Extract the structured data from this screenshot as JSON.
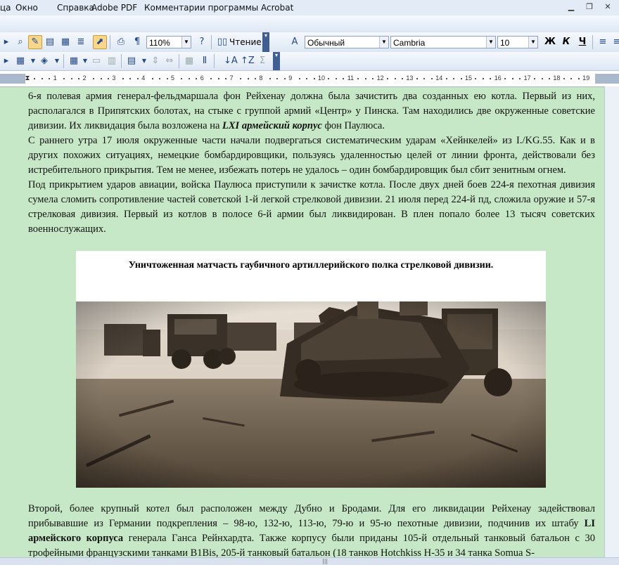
{
  "menu": {
    "items": [
      "ца",
      "Окно",
      "Справка",
      "Adobe PDF",
      "Комментарии программы Acrobat"
    ]
  },
  "toolbar": {
    "zoom": "110%",
    "read_label": "Чтение",
    "style": "Обычный",
    "font": "Cambria",
    "size": "10",
    "bold": "Ж",
    "italic": "К",
    "underline": "Ч"
  },
  "ruler": {
    "labels": [
      "1",
      "2",
      "3",
      "4",
      "5",
      "6",
      "7",
      "8",
      "9",
      "10",
      "11",
      "12",
      "13",
      "14",
      "15",
      "16",
      "17",
      "18",
      "19"
    ]
  },
  "document": {
    "p1_a": "6-я полевая армия генерал-фельдмаршала фон Рейхенау должна была зачистить два созданных ею котла. Первый из них, располагался в Припятских болотах, на стыке с группой армий «Центр» у Пинска. Там находились две окруженные советские дивизии. Их ликвидация была возложена на ",
    "p1_bold": "LXI армейский корпус",
    "p1_b": " фон Паулюса.",
    "p2": "С раннего утра 17 июля окруженные части начали подвергаться систематическим ударам «Хейнкелей» из I./KG.55. Как и в других похожих ситуациях, немецкие бомбардировщики, пользуясь удаленностью целей от линии фронта, действовали без истребительного прикрытия. Тем не менее, избежать потерь не удалось – один бомбардировщик был сбит зенитным огнем.",
    "p3": "Под прикрытием ударов авиации, войска Паулюса приступили к зачистке котла. После двух дней боев 224-я пехотная дивизия сумела сломить сопротивление частей советской 1-й легкой стрелковой дивизии. 21 июля перед 224-й пд, сложила оружие и 57-я стрелковая дивизия. Первый из котлов в полосе 6-й армии был ликвидирован. В плен попало более 13 тысяч советских военнослужащих.",
    "caption": "Уничтоженная матчасть гаубичного артиллерийского полка стрелковой дивизии.",
    "p4_a": "Второй, более крупный котел был расположен между Дубно и Бродами. Для его ликвидации Рейхенау задействовал прибывавшие из Германии подкрепления – 98-ю, 132-ю, 113-ю, 79-ю и 95-ю пехотные дивизии, подчинив их штабу ",
    "p4_bold": "LI армейского корпуса",
    "p4_b": " генерала Ганса Рейнхардта. Также корпусу были приданы 105-й отдельный танковый батальон с 30 трофейными французскими танками B1Bis, 205-й танковый батальон (18 танков Hotchkiss H-35 и 34 танка Somua S-"
  }
}
